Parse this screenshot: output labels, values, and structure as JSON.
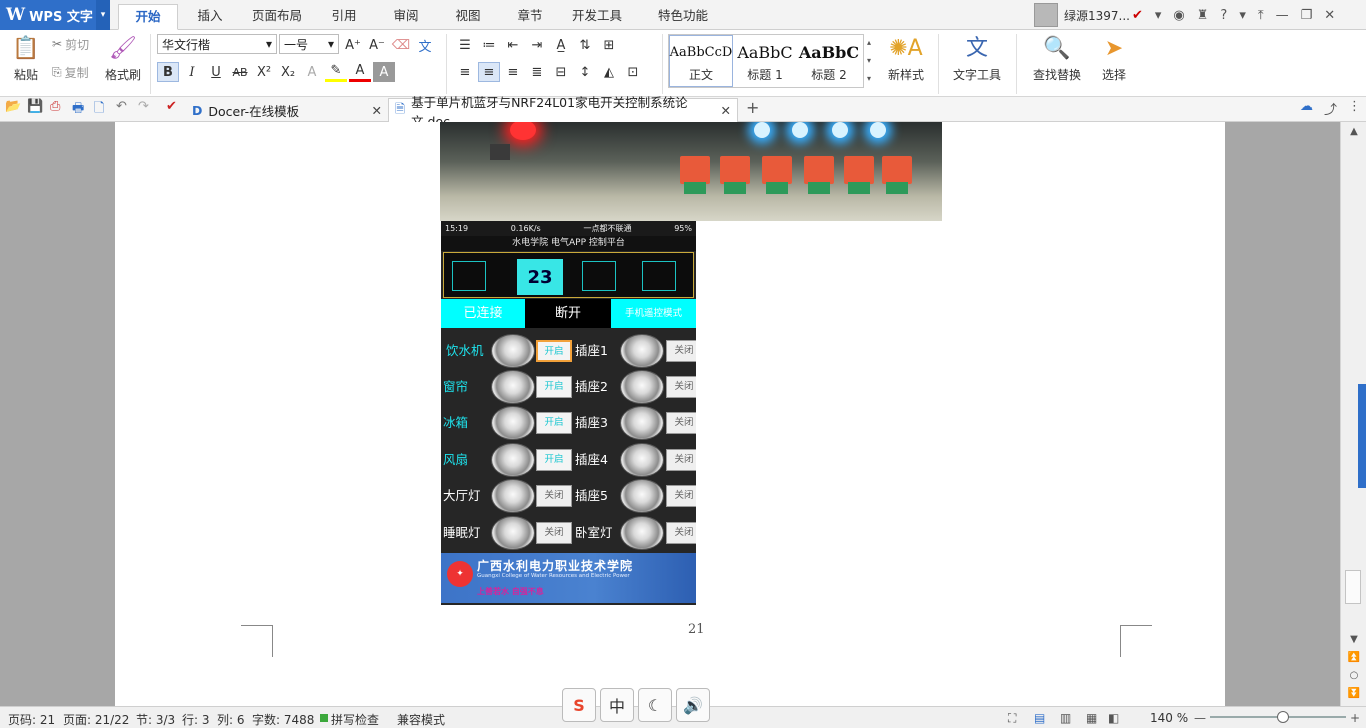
{
  "app": {
    "name": "WPS 文字",
    "logo": "W"
  },
  "menu_tabs": [
    "开始",
    "插入",
    "页面布局",
    "引用",
    "审阅",
    "视图",
    "章节",
    "开发工具",
    "特色功能"
  ],
  "active_menu_tab": "开始",
  "user": {
    "name": "绿源1397...",
    "help": "?"
  },
  "ribbon": {
    "paste": "粘贴",
    "cut": "剪切",
    "copy": "复制",
    "format_painter": "格式刷",
    "font_name": "华文行楷",
    "font_size": "一号",
    "styles": [
      {
        "sample": "AaBbCcD",
        "label": "正文"
      },
      {
        "sample": "AaBbC",
        "label": "标题 1"
      },
      {
        "sample": "AaBbC",
        "label": "标题 2"
      }
    ],
    "new_style": "新样式",
    "text_tools": "文字工具",
    "find_replace": "查找替换",
    "select": "选择"
  },
  "doc_tabs": [
    {
      "label": "Docer-在线模板"
    },
    {
      "label": "基于单片机蓝牙与NRF24L01家电开关控制系统论文.doc"
    }
  ],
  "phone": {
    "time": "15:19",
    "speed": "0.16K/s",
    "carrier": "一点都不联通",
    "battery": "95%",
    "title": "水电学院 电气APP 控制平台",
    "ac_temp": "23",
    "connected": "已连接",
    "disconnect": "断开",
    "remote_mode": "手机遥控模式",
    "devices_left": [
      {
        "name": "饮水机",
        "state": "开启"
      },
      {
        "name": "窗帘",
        "state": "开启"
      },
      {
        "name": "冰箱",
        "state": "开启"
      },
      {
        "name": "风扇",
        "state": "开启"
      },
      {
        "name": "大厅灯",
        "state": "关闭"
      },
      {
        "name": "睡眠灯",
        "state": "关闭"
      }
    ],
    "devices_right": [
      {
        "name": "插座1",
        "state": "关闭"
      },
      {
        "name": "插座2",
        "state": "关闭"
      },
      {
        "name": "插座3",
        "state": "关闭"
      },
      {
        "name": "插座4",
        "state": "关闭"
      },
      {
        "name": "插座5",
        "state": "关闭"
      },
      {
        "name": "卧室灯",
        "state": "关闭"
      }
    ],
    "college_name": "广西水利电力职业技术学院",
    "college_en": "Guangxi College of Water Resources and Electric Power",
    "motto": "上善若水  自强不息"
  },
  "page_number": "21",
  "status": {
    "page_code": "页码: 21",
    "page": "页面: 21/22",
    "section": "节: 3/3",
    "row": "行: 3",
    "col": "列: 6",
    "words": "字数: 7488",
    "spell": "拼写检查",
    "compat": "兼容模式",
    "zoom": "140 %"
  },
  "ime": [
    "S",
    "中",
    "☾",
    "🔊"
  ]
}
